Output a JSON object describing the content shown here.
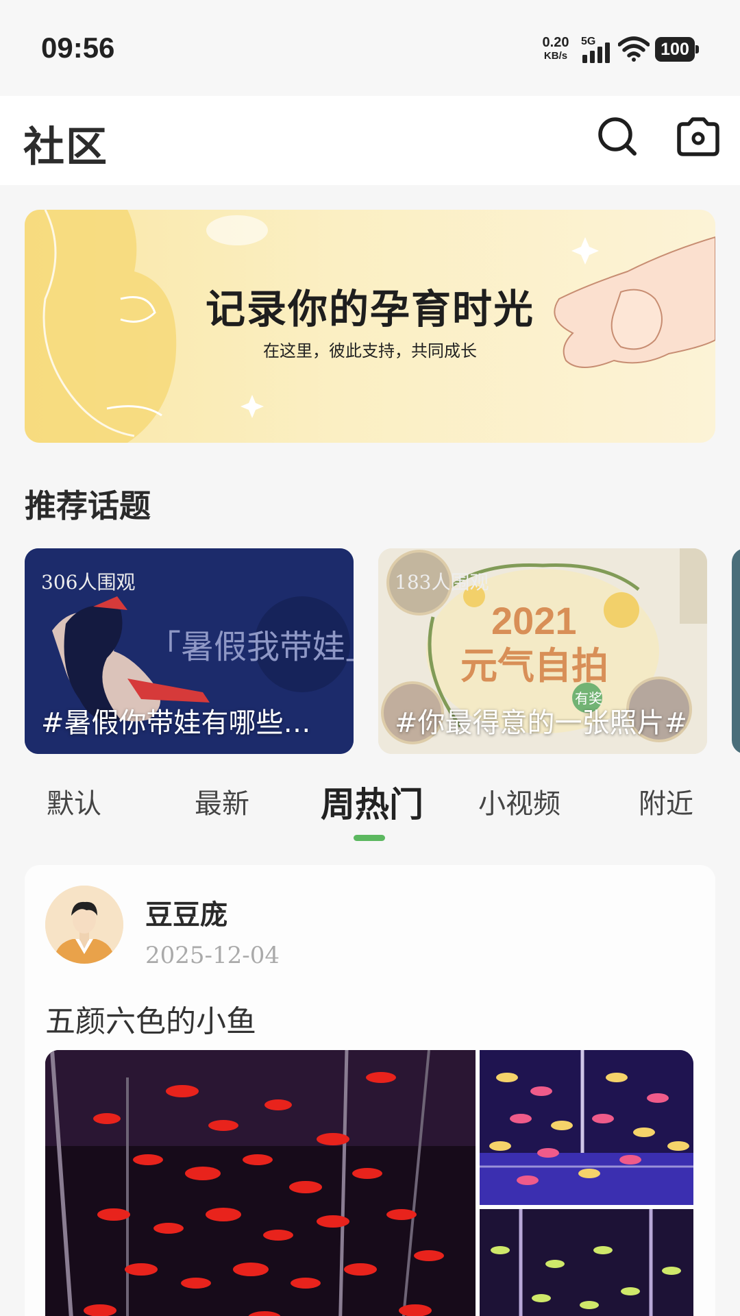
{
  "status_bar": {
    "time": "09:56",
    "net_speed_value": "0.20",
    "net_speed_unit": "KB/s",
    "network_type": "5G",
    "battery": "100"
  },
  "header": {
    "title": "社区"
  },
  "banner": {
    "title": "记录你的孕育时光",
    "subtitle": "在这里，彼此支持，共同成长"
  },
  "topics": {
    "section_title": "推荐话题",
    "items": [
      {
        "viewers": "306人围观",
        "name": "#暑假你带娃有哪些…",
        "art_text": "「暑假我带娃」"
      },
      {
        "viewers": "183人围观",
        "name": "#你最得意的一张照片#",
        "art_text_1": "2021",
        "art_text_2": "元气自拍",
        "art_badge": "有奖"
      }
    ]
  },
  "tabs": {
    "items": [
      "默认",
      "最新",
      "周热门",
      "小视频",
      "附近"
    ],
    "active": "周热门",
    "indicator_color": "#5cb860"
  },
  "post": {
    "author": "豆豆庞",
    "date": "2025-12-04",
    "text": "五颜六色的小鱼"
  }
}
